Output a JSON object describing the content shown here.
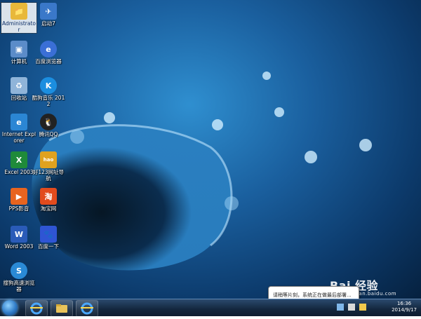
{
  "desktop": {
    "icons": [
      {
        "id": "administrator",
        "label": "Administrator",
        "color": "#e8b83a"
      },
      {
        "id": "start7",
        "label": "启动7",
        "color": "#3a78c9"
      },
      {
        "id": "computer",
        "label": "计算机",
        "color": "#5b8cc9"
      },
      {
        "id": "baidu-browser",
        "label": "百度浏览器",
        "color": "#3a6fd6"
      },
      {
        "id": "recycle-bin",
        "label": "回收站",
        "color": "#8fb4d9"
      },
      {
        "id": "kugou",
        "label": "酷狗音乐 2012",
        "color": "#1b8ee0"
      },
      {
        "id": "ie",
        "label": "Internet Explorer",
        "color": "#2b86d4"
      },
      {
        "id": "qq",
        "label": "腾讯QQ",
        "color": "#222222"
      },
      {
        "id": "excel",
        "label": "Excel 2003",
        "color": "#1f8a3a"
      },
      {
        "id": "hao123",
        "label": "好123网址导航",
        "color": "#e0a21f"
      },
      {
        "id": "pps",
        "label": "PPS影音",
        "color": "#e8641f"
      },
      {
        "id": "taobao",
        "label": "淘宝网",
        "color": "#e24b1d"
      },
      {
        "id": "word",
        "label": "Word 2003",
        "color": "#2a5bb8"
      },
      {
        "id": "baidu",
        "label": "百度一下",
        "color": "#2f55d4"
      },
      {
        "id": "sogou",
        "label": "搜狗高速浏览器",
        "color": "#2a8ad6"
      }
    ]
  },
  "taskbar": {
    "tasks": [
      {
        "id": "ie",
        "icon": "ie-icon"
      },
      {
        "id": "explorer",
        "icon": "folder-icon"
      },
      {
        "id": "ie2",
        "icon": "ie-icon"
      }
    ],
    "clock_time": "16:36",
    "clock_date": "2014/9/17"
  },
  "balloon": {
    "text": "请稍等片刻，系统正在做最后部署..."
  },
  "watermark": {
    "text": "Bai 经验",
    "sub": "jingyan.baidu.com"
  }
}
